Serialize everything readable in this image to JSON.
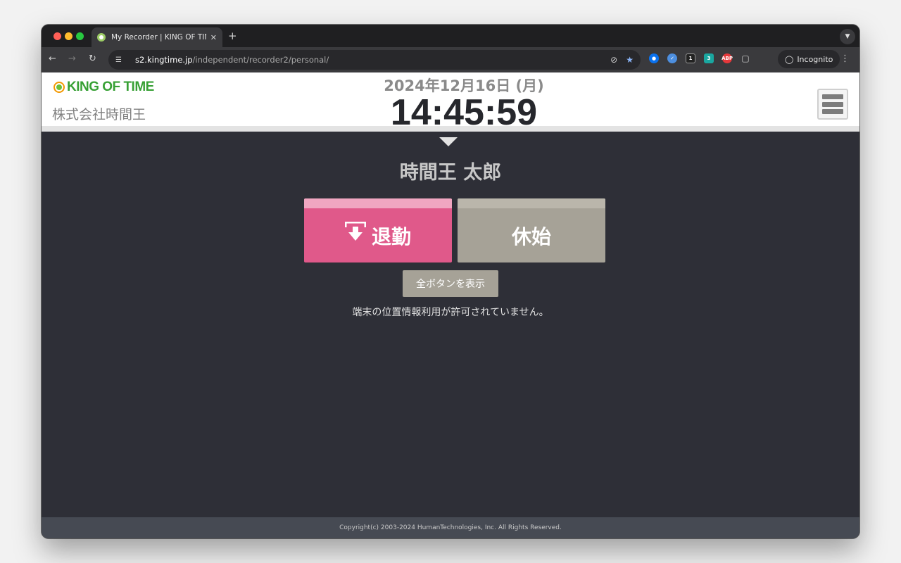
{
  "browser": {
    "tab_title": "My Recorder | KING OF TIME",
    "tab_close": "✕",
    "new_tab": "+",
    "url_host": "s2.kingtime.jp",
    "url_path": "/independent/recorder2/personal/",
    "incognito_label": "Incognito",
    "extensions": [
      {
        "name": "1password",
        "glyph": "1"
      },
      {
        "name": "bitwarden",
        "glyph": "b"
      },
      {
        "name": "ext-d",
        "badge": "1"
      },
      {
        "name": "ext-c",
        "badge": "3"
      },
      {
        "name": "adblock-plus",
        "glyph": "ABP"
      }
    ],
    "ext_badges": {
      "d": "1",
      "c": "3"
    },
    "ext_abp": "ABP"
  },
  "header": {
    "logo_text": "KING OF TIME",
    "company_name": "株式会社時間王",
    "date": "2024年12月16日 (月)",
    "time": "14:45:59"
  },
  "main": {
    "employee_name": "時間王 太郎",
    "clock_out_label": "退勤",
    "break_start_label": "休始",
    "show_all_label": "全ボタンを表示",
    "geo_message": "端末の位置情報利用が許可されていません。"
  },
  "footer": {
    "copyright": "Copyright(c) 2003-2024 HumanTechnologies, Inc. All Rights Reserved."
  },
  "colors": {
    "clock_out": "#e0598a",
    "break_start": "#a6a297",
    "page_bg": "#2e2f37",
    "logo_green": "#37a034"
  }
}
